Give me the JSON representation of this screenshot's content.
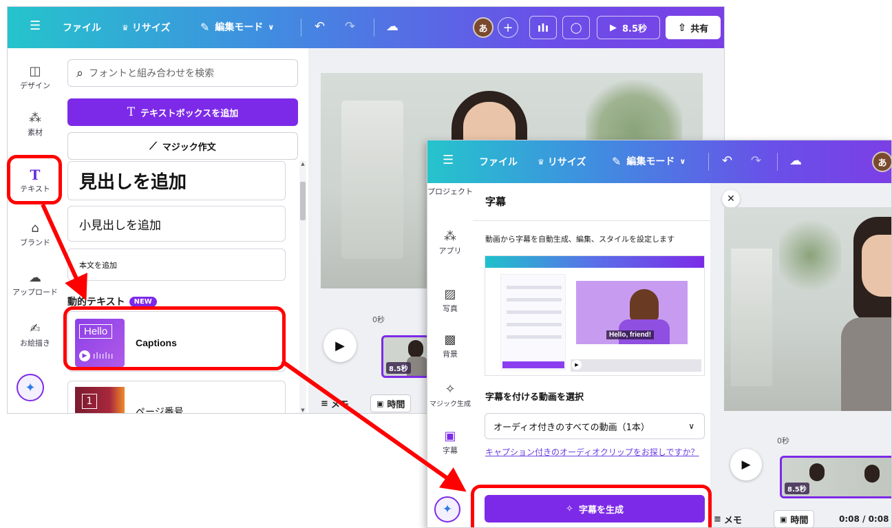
{
  "window1": {
    "topbar": {
      "menu_icon": "menu-icon",
      "file": "ファイル",
      "resize": "リサイズ",
      "edit_mode": "編集モード",
      "avatar": "あ",
      "play_time": "8.5秒",
      "share": "共有"
    },
    "rail": [
      {
        "label": "デザイン",
        "icon": "design-icon"
      },
      {
        "label": "素材",
        "icon": "elements-icon"
      },
      {
        "label": "テキスト",
        "icon": "text-icon"
      },
      {
        "label": "ブランド",
        "icon": "brand-icon"
      },
      {
        "label": "アップロード",
        "icon": "upload-icon"
      },
      {
        "label": "お絵描き",
        "icon": "draw-icon"
      }
    ],
    "panel": {
      "search_placeholder": "フォントと組み合わせを検索",
      "add_textbox": "テキストボックスを追加",
      "magic_write": "マジック作文",
      "heading": "見出しを追加",
      "subheading": "小見出しを追加",
      "body": "本文を追加",
      "dynamic_text_title": "動的テキスト",
      "new_badge": "NEW",
      "captions_thumb_text": "Hello",
      "captions_label": "Captions",
      "page_number_thumb": "1",
      "page_number_label": "ページ番号"
    },
    "timeline": {
      "time_zero": "0秒",
      "clip_duration": "8.5秒",
      "memo": "メモ",
      "time": "時間"
    }
  },
  "window2": {
    "topbar": {
      "file": "ファイル",
      "resize": "リサイズ",
      "edit_mode": "編集モード",
      "avatar": "あ"
    },
    "rail": [
      {
        "label": "プロジェクト",
        "icon": "project-icon"
      },
      {
        "label": "アプリ",
        "icon": "apps-icon"
      },
      {
        "label": "写真",
        "icon": "photo-icon"
      },
      {
        "label": "背景",
        "icon": "background-icon"
      },
      {
        "label": "マジック生成",
        "icon": "magic-generate-icon"
      },
      {
        "label": "字幕",
        "icon": "captions-icon"
      }
    ],
    "panel": {
      "title": "字幕",
      "description": "動画から字幕を自動生成、編集、スタイルを設定します",
      "illustration_caption": "Hello, friend!",
      "select_label": "字幕を付ける動画を選択",
      "select_value": "オーディオ付きのすべての動画（1本）",
      "help_link": "キャプション付きのオーディオクリップをお探しですか？",
      "generate_button": "字幕を生成"
    },
    "timeline": {
      "time_zero": "0秒",
      "clip_duration": "8.5秒",
      "memo": "メモ",
      "time": "時間",
      "timecode": "0:08 / 0:08"
    }
  },
  "colors": {
    "accent_purple": "#7d2ae8",
    "annotation_red": "#ff0000",
    "link_purple": "#6b3fe0"
  }
}
